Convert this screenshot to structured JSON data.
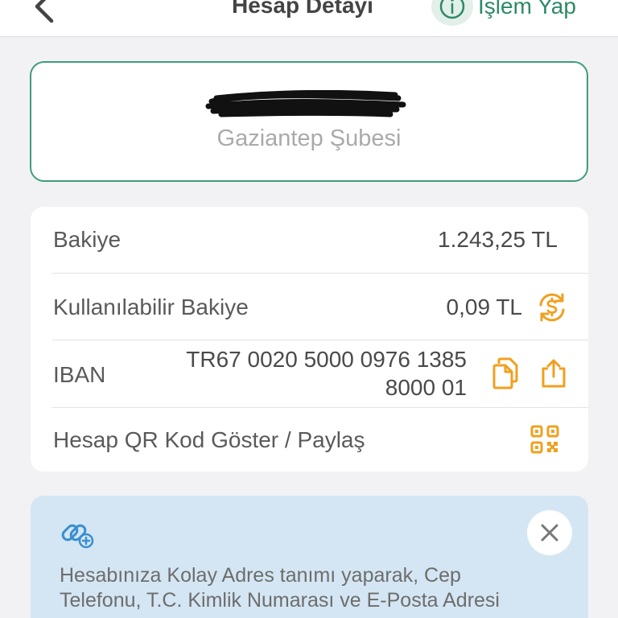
{
  "header": {
    "title": "Hesap Detayı",
    "action_label": "İşlem Yap"
  },
  "branch": {
    "name": "Gaziantep Şubesi"
  },
  "details": {
    "balance_label": "Bakiye",
    "balance_value": "1.243,25 TL",
    "available_label": "Kullanılabilir Bakiye",
    "available_value": "0,09 TL",
    "iban_label": "IBAN",
    "iban_line1": "TR67 0020 5000 0976 1385",
    "iban_line2": "8000 01",
    "qr_label": "Hesap QR Kod Göster / Paylaş"
  },
  "info": {
    "text": "Hesabınıza Kolay Adres tanımı yaparak, Cep Telefonu, T.C. Kimlik Numarası ve E-Posta Adresi"
  },
  "colors": {
    "accent_green": "#3f9c7a",
    "accent_orange": "#f0a020",
    "info_bg": "#d4e6f3"
  },
  "icons": {
    "back": "chevron-left-icon",
    "action": "info-circle-icon",
    "exchange": "currency-exchange-icon",
    "copy": "copy-icon",
    "share": "share-icon",
    "qr": "qr-code-icon",
    "link": "link-add-icon",
    "close": "close-icon"
  }
}
